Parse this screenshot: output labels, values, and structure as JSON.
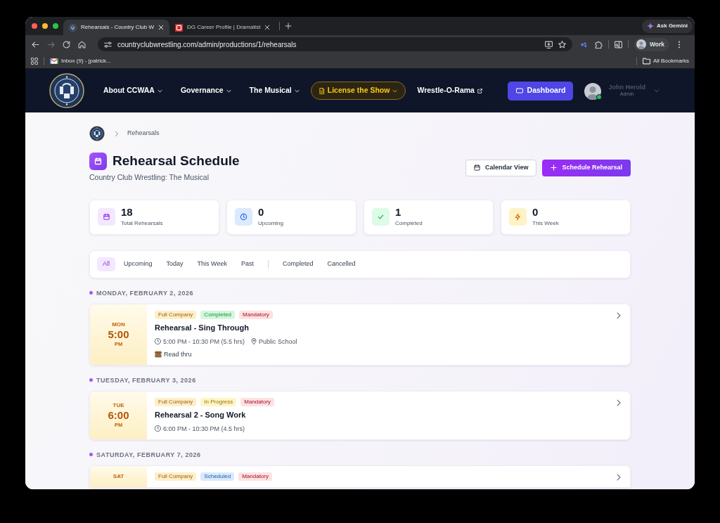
{
  "browser": {
    "tabs": [
      {
        "title": "Rehearsals - Country Club W",
        "kind": "crest",
        "selected": true
      },
      {
        "title": "DG Career Profile | Dramatist",
        "kind": "square",
        "selected": false
      }
    ],
    "gemini_button": "Ask Gemini",
    "forward_button": {
      "disabled": true
    },
    "url": "countryclubwrestling.com/admin/productions/1/rehearsals",
    "profile": "Work",
    "bookmarks": [
      {
        "label": "Inbox (9) - jpatrick...",
        "kind": "mail"
      }
    ],
    "all_bookmarks": "All Bookmarks"
  },
  "navbar": {
    "items": [
      {
        "label": "About CCWAA",
        "kind": "dropdown"
      },
      {
        "label": "Governance",
        "kind": "dropdown"
      },
      {
        "label": "The Musical",
        "kind": "dropdown"
      },
      {
        "label": "License the Show",
        "kind": "featured"
      },
      {
        "label": "Wrestle-O-Rama",
        "kind": "external"
      }
    ],
    "dashboard_button": "Dashboard",
    "user": {
      "name": "John Herold",
      "role": "Admin",
      "online": true
    }
  },
  "breadcrumb": {
    "current": "Rehearsals"
  },
  "header": {
    "title": "Rehearsal Schedule",
    "subtitle": "Country Club Wrestling: The Musical",
    "buttons": [
      {
        "label": "Calendar View",
        "kind": "secondary"
      },
      {
        "label": "Schedule Rehearsal",
        "kind": "primary"
      }
    ]
  },
  "stats": [
    {
      "value": "18",
      "label": "Total Rehearsals",
      "kind": "total"
    },
    {
      "value": "0",
      "label": "Upcoming",
      "kind": "upcoming"
    },
    {
      "value": "1",
      "label": "Completed",
      "kind": "completed"
    },
    {
      "value": "0",
      "label": "This Week",
      "kind": "week"
    }
  ],
  "filter_groups": [
    [
      {
        "label": "All",
        "selected": true
      },
      {
        "label": "Upcoming",
        "selected": false
      },
      {
        "label": "Today",
        "selected": false
      },
      {
        "label": "This Week",
        "selected": false
      },
      {
        "label": "Past",
        "selected": false
      }
    ],
    [
      {
        "label": "Completed",
        "selected": false
      },
      {
        "label": "Cancelled",
        "selected": false
      }
    ]
  ],
  "days": [
    {
      "heading": "MONDAY, FEBRUARY 2, 2026",
      "rehearsals": [
        {
          "day": "MON",
          "time": "5:00",
          "meridiem": "PM",
          "tags": [
            {
              "label": "Full Company",
              "color": "#fdefc7"
            },
            {
              "label": "Completed",
              "color": "#d5f5e0"
            },
            {
              "label": "Mandatory",
              "color": "#fde2e2"
            }
          ],
          "title": "Rehearsal - Sing Through",
          "time_range": "5:00 PM - 10:30 PM (5.5 hrs)",
          "location": "Public School",
          "note": "Read thru"
        }
      ]
    },
    {
      "heading": "TUESDAY, FEBRUARY 3, 2026",
      "rehearsals": [
        {
          "day": "TUE",
          "time": "6:00",
          "meridiem": "PM",
          "tags": [
            {
              "label": "Full Company",
              "color": "#fdefc7"
            },
            {
              "label": "In Progress",
              "color": "#fdf5c4"
            },
            {
              "label": "Mandatory",
              "color": "#fde2e2"
            }
          ],
          "title": "Rehearsal 2 - Song Work",
          "time_range": "6:00 PM - 10:30 PM (4.5 hrs)"
        }
      ]
    },
    {
      "heading": "SATURDAY, FEBRUARY 7, 2026",
      "rehearsals": [
        {
          "day": "SAT",
          "tags": [
            {
              "label": "Full Company",
              "color": "#fdefc7"
            },
            {
              "label": "Scheduled",
              "color": "#dbe8fd"
            },
            {
              "label": "Mandatory",
              "color": "#fde2e2"
            }
          ]
        }
      ]
    }
  ]
}
